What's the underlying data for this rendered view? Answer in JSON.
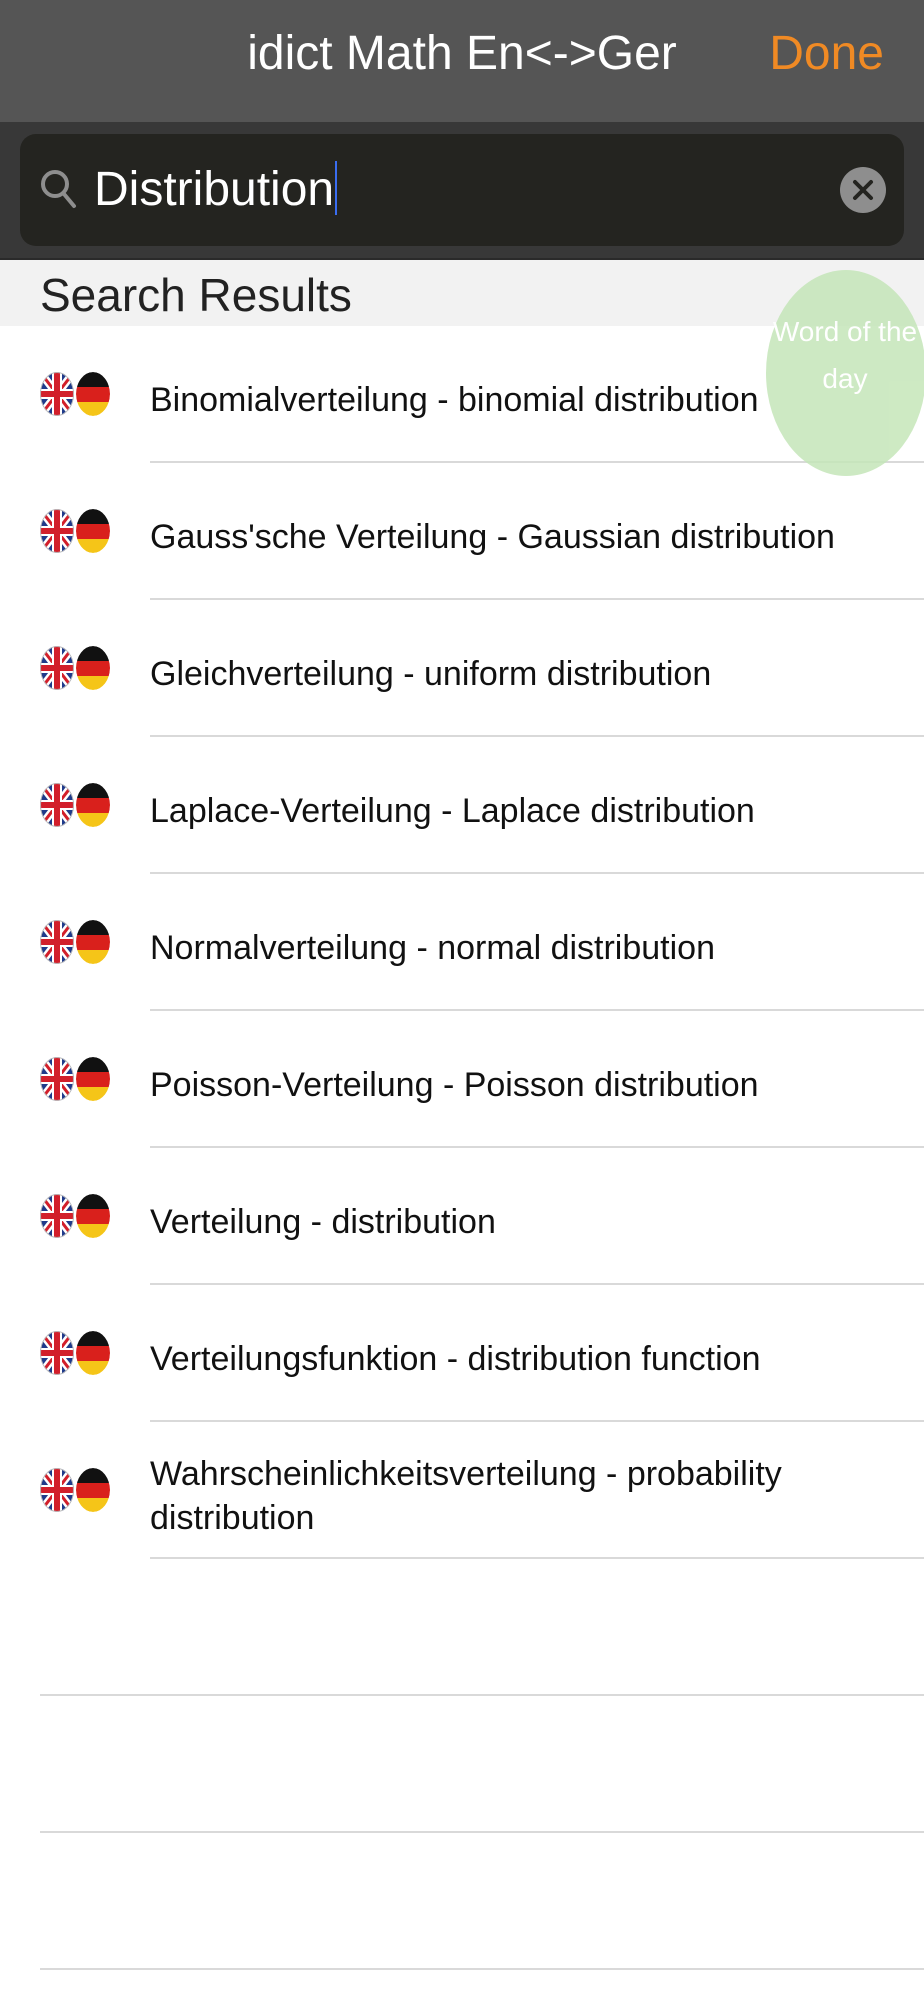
{
  "navbar": {
    "title": "idict Math En<->Ger",
    "done_label": "Done"
  },
  "search": {
    "value": "Distribution",
    "icon": "search-icon",
    "clear_icon": "clear-icon"
  },
  "results": {
    "header": "Search Results",
    "items": [
      {
        "label": "Binomialverteilung - binomial distribution"
      },
      {
        "label": "Gauss'sche Verteilung - Gaussian distribution"
      },
      {
        "label": "Gleichverteilung - uniform distribution"
      },
      {
        "label": "Laplace-Verteilung - Laplace distribution"
      },
      {
        "label": "Normalverteilung - normal distribution"
      },
      {
        "label": "Poisson-Verteilung - Poisson distribution"
      },
      {
        "label": "Verteilung - distribution"
      },
      {
        "label": "Verteilungsfunktion - distribution function"
      },
      {
        "label": "Wahrscheinlichkeitsverteilung - probability distribution"
      }
    ]
  },
  "word_of_the_day": {
    "label": "Word of the day"
  },
  "colors": {
    "navbar_bg": "#555555",
    "accent": "#f08a24",
    "search_bg": "#383838",
    "wotd_bg": "#c5e6b9"
  }
}
